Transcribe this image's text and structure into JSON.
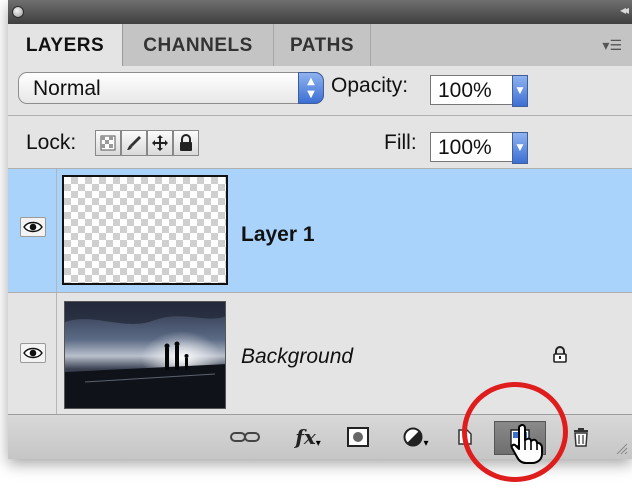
{
  "tabs": [
    {
      "label": "LAYERS",
      "active": true
    },
    {
      "label": "CHANNELS",
      "active": false
    },
    {
      "label": "PATHS",
      "active": false
    }
  ],
  "blend_mode": {
    "value": "Normal"
  },
  "opacity": {
    "label": "Opacity:",
    "value": "100%"
  },
  "lock": {
    "label": "Lock:",
    "icons": [
      "lock-transparent-pixels-icon",
      "lock-image-pixels-icon",
      "lock-position-icon",
      "lock-all-icon"
    ]
  },
  "fill": {
    "label": "Fill:",
    "value": "100%"
  },
  "layers": [
    {
      "name": "Layer 1",
      "selected": true,
      "visible": true,
      "locked": false,
      "thumbnail": "transparent"
    },
    {
      "name": "Background",
      "selected": false,
      "visible": true,
      "locked": true,
      "thumbnail": "sunset-photo",
      "italic": true
    }
  ],
  "bottom_bar": {
    "icons": [
      "link-layers-icon",
      "layer-style-fx-icon",
      "add-mask-icon",
      "adjustment-layer-icon",
      "new-group-icon",
      "new-layer-icon",
      "trash-icon"
    ],
    "fx_label": "fx"
  },
  "colors": {
    "selected_row": "#a9d3fb",
    "panel_bg": "#e4e4e4",
    "highlight_circle": "#e01d1d",
    "accent_blue": "#3c6fd4"
  },
  "cursor": "pointing-hand-cursor"
}
